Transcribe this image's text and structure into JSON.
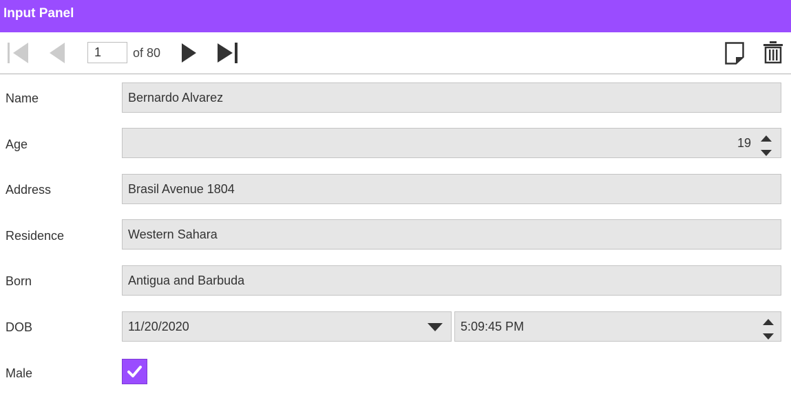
{
  "header": {
    "title": "Input Panel"
  },
  "toolbar": {
    "current_page": "1",
    "total_label": "of 80",
    "icons": {
      "first": "first-page-icon",
      "previous": "previous-page-icon",
      "next": "next-page-icon",
      "last": "last-page-icon",
      "add": "new-item-icon",
      "delete": "trash-icon"
    }
  },
  "form": {
    "name": {
      "label": "Name",
      "value": "Bernardo Alvarez"
    },
    "age": {
      "label": "Age",
      "value": "19"
    },
    "address": {
      "label": "Address",
      "value": "Brasil Avenue 1804"
    },
    "residence": {
      "label": "Residence",
      "value": "Western Sahara"
    },
    "born": {
      "label": "Born",
      "value": "Antigua and Barbuda"
    },
    "dob": {
      "label": "DOB",
      "date": "11/20/2020",
      "time": "5:09:45 PM"
    },
    "male": {
      "label": "Male",
      "checked": true
    }
  },
  "colors": {
    "accent": "#9a4cff",
    "field_bg": "#e6e6e6",
    "field_border": "#c4c4c4",
    "disabled_icon": "#cccccc",
    "icon": "#333333"
  }
}
